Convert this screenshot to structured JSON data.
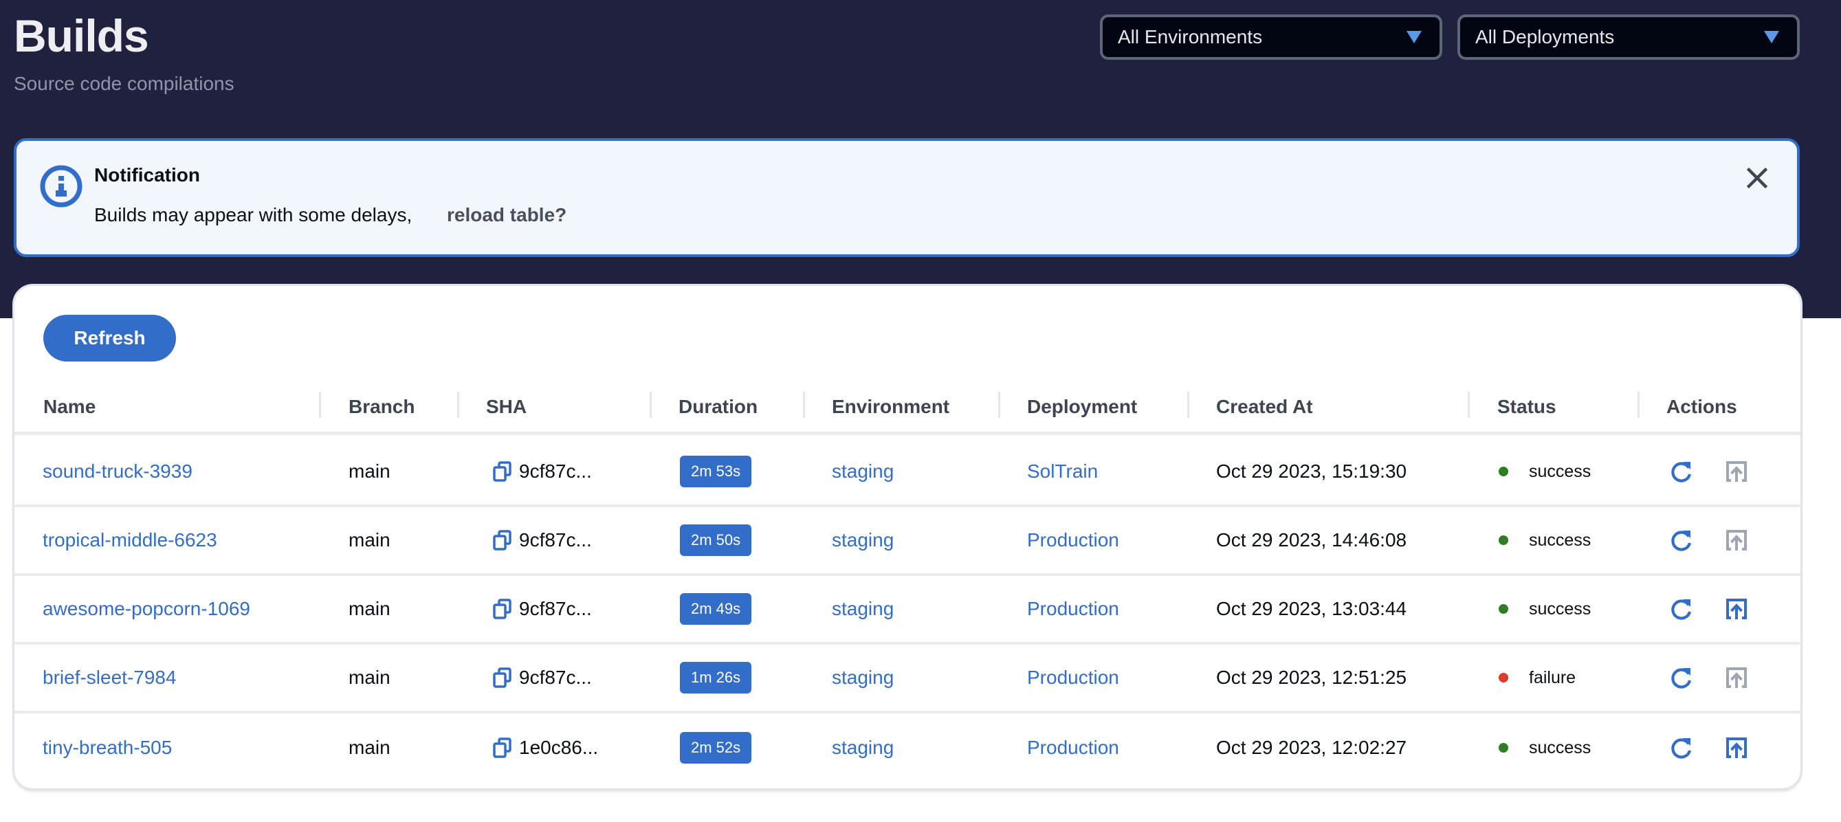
{
  "header": {
    "title": "Builds",
    "subtitle": "Source code compilations",
    "filters": [
      {
        "label": "All Environments",
        "icon": "caret-down-icon"
      },
      {
        "label": "All Deployments",
        "icon": "caret-down-icon"
      }
    ]
  },
  "notification": {
    "icon": "info-icon",
    "title": "Notification",
    "message": "Builds may appear with some delays,",
    "link": "reload table?",
    "close_icon": "close-icon"
  },
  "toolbar": {
    "refresh_label": "Refresh"
  },
  "table": {
    "columns": [
      "Name",
      "Branch",
      "SHA",
      "Duration",
      "Environment",
      "Deployment",
      "Created At",
      "Status",
      "Actions"
    ],
    "rows": [
      {
        "name": "sound-truck-3939",
        "branch": "main",
        "sha": "9cf87c...",
        "duration": "2m 53s",
        "environment": "staging",
        "deployment": "SolTrain",
        "created_at": "Oct 29 2023, 15:19:30",
        "status": "success",
        "promote_enabled": false
      },
      {
        "name": "tropical-middle-6623",
        "branch": "main",
        "sha": "9cf87c...",
        "duration": "2m 50s",
        "environment": "staging",
        "deployment": "Production",
        "created_at": "Oct 29 2023, 14:46:08",
        "status": "success",
        "promote_enabled": false
      },
      {
        "name": "awesome-popcorn-1069",
        "branch": "main",
        "sha": "9cf87c...",
        "duration": "2m 49s",
        "environment": "staging",
        "deployment": "Production",
        "created_at": "Oct 29 2023, 13:03:44",
        "status": "success",
        "promote_enabled": true
      },
      {
        "name": "brief-sleet-7984",
        "branch": "main",
        "sha": "9cf87c...",
        "duration": "1m 26s",
        "environment": "staging",
        "deployment": "Production",
        "created_at": "Oct 29 2023, 12:51:25",
        "status": "failure",
        "promote_enabled": false
      },
      {
        "name": "tiny-breath-505",
        "branch": "main",
        "sha": "1e0c86...",
        "duration": "2m 52s",
        "environment": "staging",
        "deployment": "Production",
        "created_at": "Oct 29 2023, 12:02:27",
        "status": "success",
        "promote_enabled": true
      }
    ]
  },
  "colors": {
    "header_bg": "#20203f",
    "accent": "#326ec9",
    "success": "#2e7d22",
    "failure": "#e5392b",
    "disabled": "#9ea6b3"
  }
}
